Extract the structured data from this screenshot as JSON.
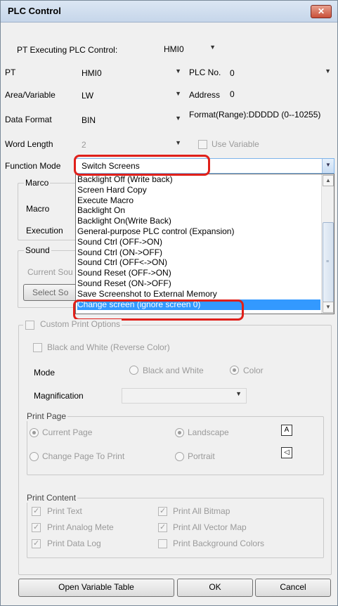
{
  "window": {
    "title": "PLC Control",
    "close_icon": "close-icon"
  },
  "pt_executing": {
    "label": "PT Executing PLC Control:",
    "value": "HMI0"
  },
  "pt": {
    "label": "PT",
    "value": "HMI0"
  },
  "plc_no": {
    "label": "PLC No.",
    "value": "0"
  },
  "area": {
    "label": "Area/Variable",
    "value": "LW"
  },
  "address": {
    "label": "Address",
    "value": "0"
  },
  "data_format": {
    "label": "Data Format",
    "value": "BIN",
    "format_range": "Format(Range):DDDDD (0--10255)"
  },
  "word_length": {
    "label": "Word Length",
    "value": "2",
    "use_variable": "Use Variable"
  },
  "function_mode": {
    "label": "Function Mode",
    "value": "Switch Screens",
    "options": [
      "Backlight Off (Write back)",
      "Screen Hard Copy",
      "Execute Macro",
      "Backlight On",
      "Backlight On(Write Back)",
      "General-purpose PLC control (Expansion)",
      "Sound Ctrl (OFF->ON)",
      "Sound Ctrl (ON->OFF)",
      "Sound Ctrl (OFF<->ON)",
      "Sound Reset (OFF->ON)",
      "Sound Reset (ON->OFF)",
      "Save Screenshot to External Memory",
      "Change screen (ignore screen 0)"
    ],
    "selected_option": "Change screen (ignore screen 0)"
  },
  "macro_group": {
    "title": "Marco",
    "macro_label": "Macro",
    "execution_label": "Execution"
  },
  "sound_group": {
    "title": "Sound",
    "current_label": "Current Sou",
    "select_button": "Select So"
  },
  "print_options": {
    "title": "Custom Print Options",
    "black_white_reverse": "Black and White (Reverse Color)",
    "mode_label": "Mode",
    "mode_bw": "Black and White",
    "mode_color": "Color",
    "magnification_label": "Magnification",
    "magnification_value": ""
  },
  "print_page": {
    "title": "Print Page",
    "current_page": "Current Page",
    "change_page": "Change Page To Print",
    "landscape": "Landscape",
    "portrait": "Portrait",
    "landscape_icon": "A",
    "portrait_icon": "◁"
  },
  "print_content": {
    "title": "Print Content",
    "print_text": "Print Text",
    "print_analog": "Print Analog Mete",
    "print_datalog": "Print Data Log",
    "print_bitmap": "Print All Bitmap",
    "print_vector": "Print All Vector Map",
    "print_bg_colors": "Print Background Colors"
  },
  "buttons": {
    "open_variable_table": "Open Variable Table",
    "ok": "OK",
    "cancel": "Cancel"
  },
  "colors": {
    "highlight": "#3399ff",
    "annotation": "#e0201a"
  }
}
